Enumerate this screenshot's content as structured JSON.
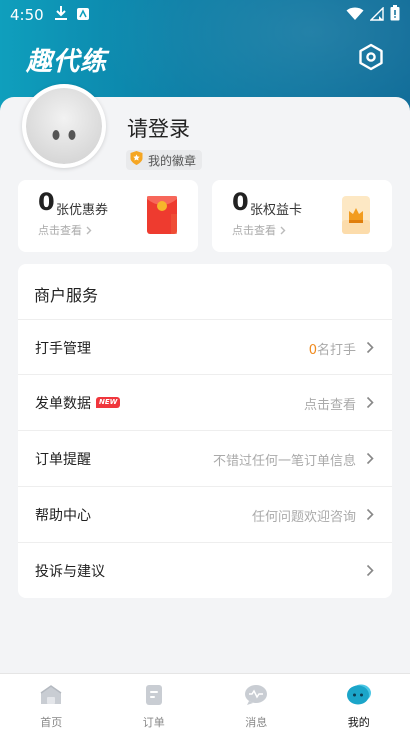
{
  "status_bar": {
    "time": "4:50"
  },
  "header": {
    "title": "趣代练"
  },
  "profile": {
    "login_text": "请登录",
    "badge_label": "我的徽章"
  },
  "stats": [
    {
      "count": "0",
      "unit": "张优惠券",
      "link": "点击查看"
    },
    {
      "count": "0",
      "unit": "张权益卡",
      "link": "点击查看"
    }
  ],
  "services": {
    "title": "商户服务",
    "items": [
      {
        "label": "打手管理",
        "value_count": "0",
        "value_text": "名打手"
      },
      {
        "label": "发单数据",
        "tag": "NEW",
        "value_text": "点击查看"
      },
      {
        "label": "订单提醒",
        "value_text": "不错过任何一笔订单信息"
      },
      {
        "label": "帮助中心",
        "value_text": "任何问题欢迎咨询"
      },
      {
        "label": "投诉与建议",
        "value_text": ""
      }
    ]
  },
  "tabbar": {
    "items": [
      {
        "label": "首页",
        "icon": "home-icon",
        "active": false
      },
      {
        "label": "订单",
        "icon": "order-icon",
        "active": false
      },
      {
        "label": "消息",
        "icon": "message-icon",
        "active": false
      },
      {
        "label": "我的",
        "icon": "profile-icon",
        "active": true
      }
    ]
  },
  "colors": {
    "header": "#0b7ea6",
    "accent": "#f08a1e",
    "tag": "#f0363c",
    "active_tab_icon": "#1ba5c9"
  }
}
